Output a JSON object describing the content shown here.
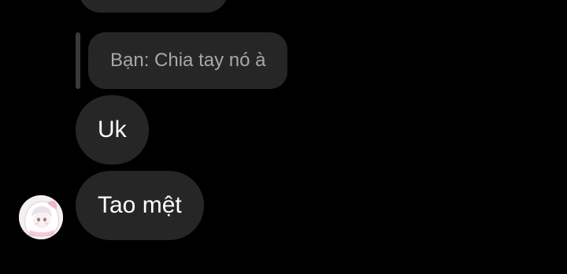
{
  "conversation": {
    "reply": {
      "text": "Bạn: Chia tay nó à"
    },
    "messages": [
      {
        "text": "Uk"
      },
      {
        "text": "Tao mệt"
      }
    ]
  },
  "avatar": {
    "icon": "anime-avatar-icon"
  },
  "colors": {
    "background": "#000000",
    "bubble": "#262626",
    "reply_text": "#a8a8a8",
    "message_text": "#ffffff"
  }
}
